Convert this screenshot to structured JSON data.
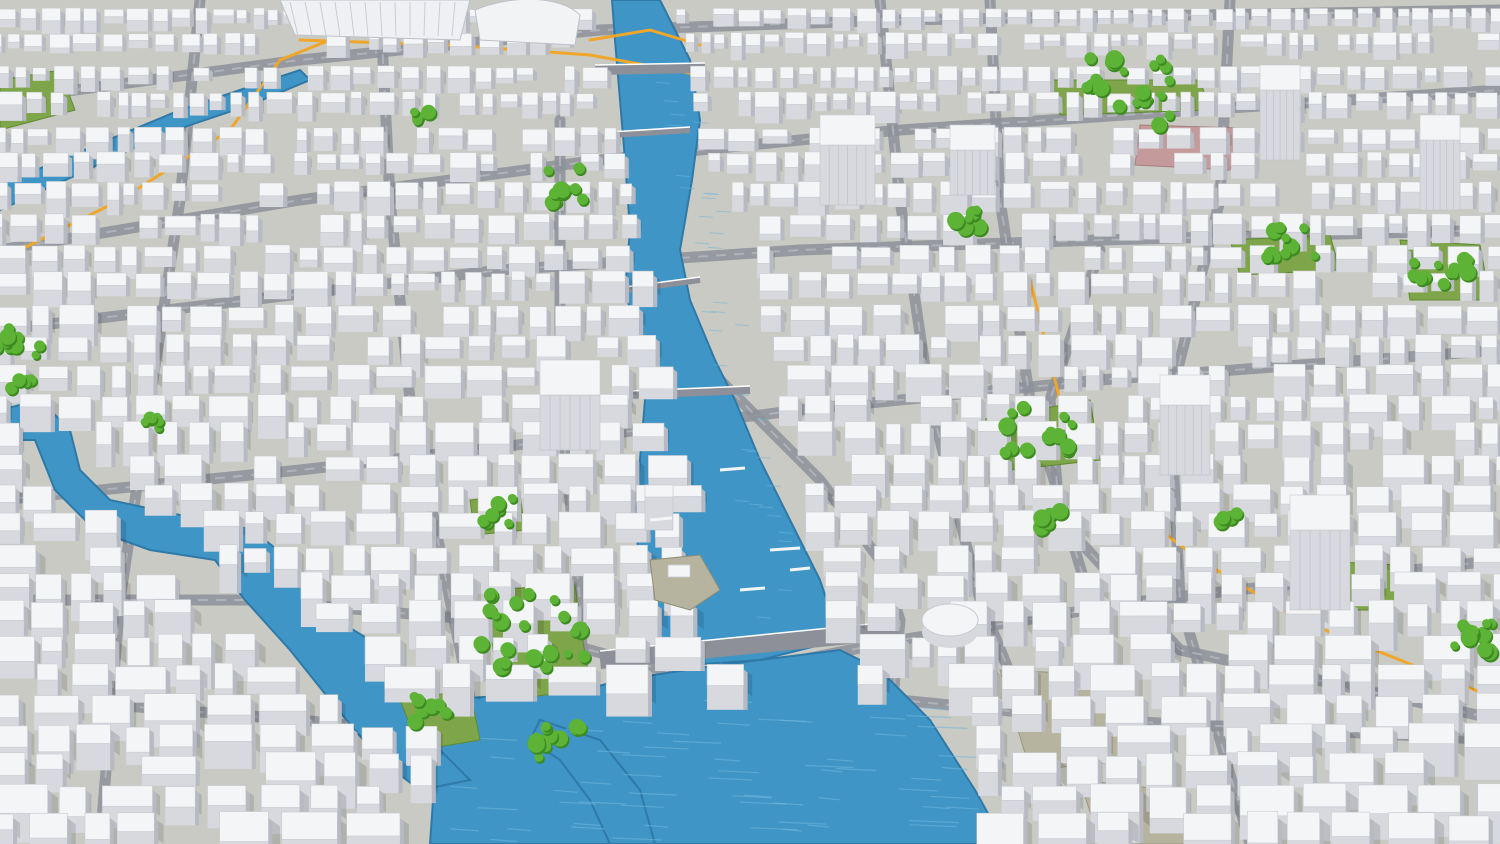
{
  "scene": {
    "kind": "3d-city-model-render",
    "palette": {
      "ground": "#c9cac3",
      "street": "#8d9099",
      "street_light": "#b9bcc4",
      "building_top": "#f4f5f7",
      "building_side": "#d7d9de",
      "building_shadow": "#b7bac2",
      "water": "#3f95c6",
      "water_dark": "#2f79a8",
      "water_light": "#6fb6dc",
      "park": "#7fa54a",
      "tree": "#5cb335",
      "tree_dark": "#3d8a22",
      "tram_line": "#f0a62a",
      "plaza": "#b6b39e",
      "sports_field": "#c59a9a"
    },
    "features": [
      "river",
      "canal",
      "lake",
      "bridges",
      "city-blocks",
      "parks",
      "tram-lines",
      "rail-station",
      "high-rise-towers"
    ]
  }
}
